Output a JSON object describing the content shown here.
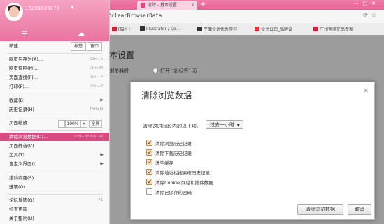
{
  "tab": {
    "title": "清除 - 基本设置"
  },
  "address": {
    "url": "a/clearBrowserData"
  },
  "bookmarks": [
    "[猫扑]",
    "Illustrator / Co...",
    "平面设计优秀学习",
    "设计公司_品牌设",
    "广州宝滢艺品专家"
  ],
  "page": {
    "title": "本设置",
    "setting_label": "浏览器时",
    "setting_option": "打开 \"新标签\" 页"
  },
  "dialog": {
    "title": "清除浏览数据",
    "range_label": "清除这时间段内的以下项:",
    "range_value": "过去一小时",
    "options": [
      {
        "label": "清除浏览历史记录",
        "checked": true
      },
      {
        "label": "清除下载历史记录",
        "checked": true
      },
      {
        "label": "清空缓存",
        "checked": true
      },
      {
        "label": "清除地址栏搜索框历史记录",
        "checked": true
      },
      {
        "label": "清除Cookie,网站和插件数据",
        "checked": true
      },
      {
        "label": "清除已保存的密码",
        "checked": false
      }
    ],
    "confirm": "清除浏览数据",
    "cancel": "取消"
  },
  "menu": {
    "username": "15201628173",
    "new_label": "新建",
    "new_tab_btn": "标签",
    "new_window_btn": "窗口",
    "group1": [
      {
        "label": "网页另存为(A)...",
        "shortcut": "Ctrl+S"
      },
      {
        "label": "网页快照(M)...",
        "shortcut": "Ctrl+M"
      },
      {
        "label": "页面查找(F)...",
        "shortcut": "Ctrl+F"
      },
      {
        "label": "打印(P)...",
        "shortcut": "Ctrl+P"
      }
    ],
    "group2": [
      {
        "label": "收藏(B)"
      },
      {
        "label": "历史记录(H)",
        "shortcut": "Ctrl+H"
      }
    ],
    "zoom_label": "页面缩放",
    "zoom_minus": "-",
    "zoom_value": "100%",
    "zoom_plus": "+",
    "fullscreen": "全屏",
    "group3": [
      {
        "label": "清除浏览数据(D)...",
        "shortcut": "Ctrl+Shift+Del"
      },
      {
        "label": "页面静音(V)"
      },
      {
        "label": "工具(T)"
      },
      {
        "label": "自定义界面(I)"
      }
    ],
    "group4": [
      {
        "label": "猎豹商店(S)"
      },
      {
        "label": "选项(O)"
      }
    ],
    "group5": [
      {
        "label": "论坛反馈(Q)",
        "shortcut": "F1"
      },
      {
        "label": "检查更新"
      },
      {
        "label": "关于猎豹(U)"
      }
    ]
  }
}
